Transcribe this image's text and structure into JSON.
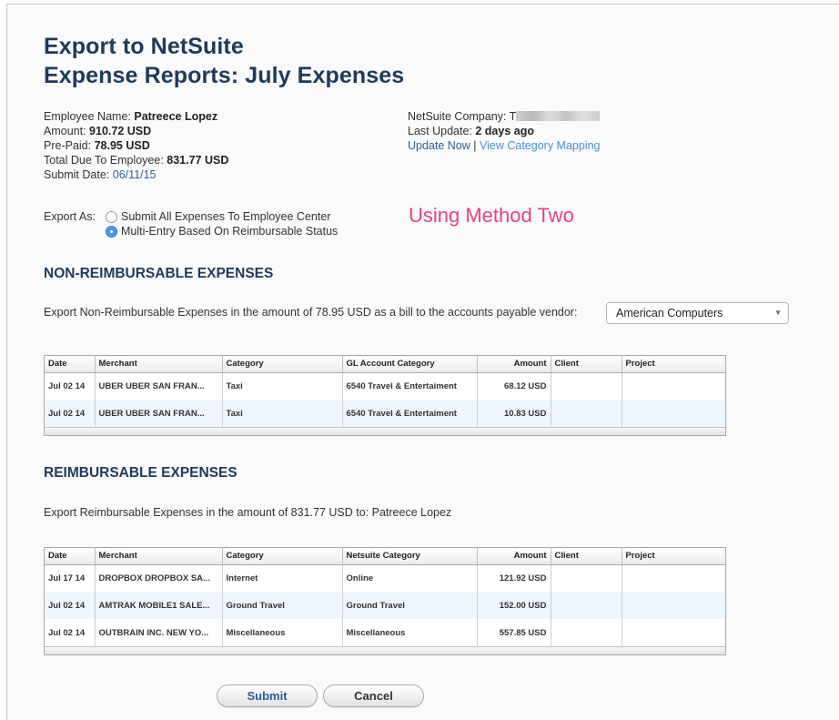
{
  "header": {
    "title_line1": "Export to NetSuite",
    "title_line2": "Expense Reports: July Expenses"
  },
  "report": {
    "employee_label": "Employee Name:",
    "employee_value": "Patreece Lopez",
    "amount_label": "Amount:",
    "amount_value": "910.72 USD",
    "prepaid_label": "Pre-Paid:",
    "prepaid_value": "78.95 USD",
    "total_due_label": "Total Due To Employee:",
    "total_due_value": "831.77 USD",
    "submit_date_label": "Submit Date:",
    "submit_date_value": "06/11/15"
  },
  "netsuite": {
    "company_label": "NetSuite Company:",
    "company_value": "T",
    "last_update_label": "Last Update:",
    "last_update_value": "2 days ago",
    "update_now_link": "Update Now",
    "separator": "|",
    "category_mapping_link": "View Category Mapping"
  },
  "export_as": {
    "label": "Export As:",
    "options": [
      {
        "label": "Submit All Expenses To Employee Center",
        "selected": false
      },
      {
        "label": "Multi-Entry Based On Reimbursable Status",
        "selected": true
      }
    ]
  },
  "annotation": {
    "text": "Using Method Two",
    "color": "#e8437a"
  },
  "non_reimbursable": {
    "title": "NON-REIMBURSABLE EXPENSES",
    "sentence": "Export Non-Reimbursable Expenses in the amount of 78.95 USD as a bill to the accounts payable vendor:",
    "vendor_selected": "American Computers",
    "columns": [
      "Date",
      "Merchant",
      "Category",
      "GL Account Category",
      "Amount",
      "Client",
      "Project"
    ],
    "rows": [
      [
        "Jul 02 14",
        "UBER UBER SAN FRAN...",
        "Taxi",
        "6540 Travel & Entertaiment",
        "68.12 USD",
        "",
        ""
      ],
      [
        "Jul 02 14",
        "UBER UBER SAN FRAN...",
        "Taxi",
        "6540 Travel & Entertaiment",
        "10.83 USD",
        "",
        ""
      ]
    ]
  },
  "reimbursable": {
    "title": "REIMBURSABLE EXPENSES",
    "sentence": "Export Reimbursable Expenses in the amount of 831.77 USD to: Patreece Lopez",
    "columns": [
      "Date",
      "Merchant",
      "Category",
      "Netsuite Category",
      "Amount",
      "Client",
      "Project"
    ],
    "rows": [
      [
        "Jul 17 14",
        "DROPBOX DROPBOX SA...",
        "Internet",
        "Online",
        "121.92 USD",
        "",
        ""
      ],
      [
        "Jul 02 14",
        "AMTRAK MOBILE1 SALE...",
        "Ground Travel",
        "Ground Travel",
        "152.00 USD",
        "",
        ""
      ],
      [
        "Jul 02 14",
        "OUTBRAIN INC. NEW YO...",
        "Miscellaneous",
        "Miscellaneous",
        "557.85 USD",
        "",
        ""
      ]
    ]
  },
  "actions": {
    "submit_label": "Submit",
    "cancel_label": "Cancel"
  },
  "colors": {
    "title": "#1d3b5a",
    "link": "#2f6199",
    "radio_selected": "#4a96e8",
    "alt_row": "#eef5fd"
  }
}
